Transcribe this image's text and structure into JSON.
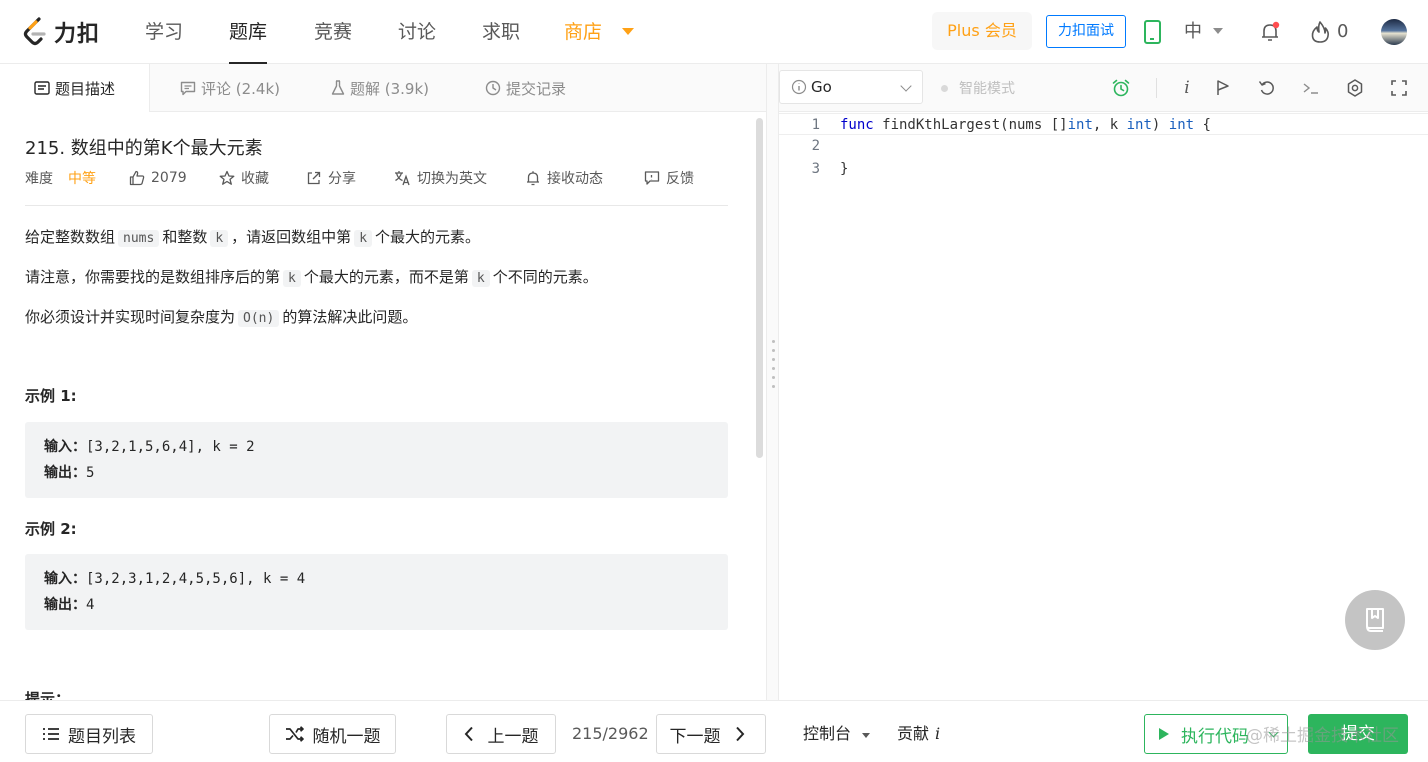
{
  "nav": {
    "logo_text": "力扣",
    "items": [
      "学习",
      "题库",
      "竞赛",
      "讨论",
      "求职",
      "商店"
    ],
    "active_index": 1,
    "plus_label": "Plus 会员",
    "interview_label": "力扣面试",
    "language": "中",
    "fire_count": "0"
  },
  "left_tabs": [
    "题目描述",
    "评论 (2.4k)",
    "题解 (3.9k)",
    "提交记录"
  ],
  "problem": {
    "title": "215. 数组中的第K个最大元素",
    "difficulty_label": "难度",
    "difficulty": "中等",
    "likes": "2079",
    "favorite": "收藏",
    "share": "分享",
    "switch_lang": "切换为英文",
    "notify": "接收动态",
    "feedback": "反馈",
    "p1_a": "给定整数数组",
    "p1_code1": "nums",
    "p1_b": "和整数",
    "p1_code2": "k",
    "p1_c": "，请返回数组中第",
    "p1_code3": "k",
    "p1_d": "个最大的元素。",
    "p2_a": "请注意，你需要找的是数组排序后的第",
    "p2_code1": "k",
    "p2_b": "个最大的元素，而不是第",
    "p2_code2": "k",
    "p2_c": "个不同的元素。",
    "p3_a": "你必须设计并实现时间复杂度为",
    "p3_code": "O(n)",
    "p3_b": "的算法解决此问题。",
    "example1_title": "示例 1:",
    "example1_input_label": "输入：",
    "example1_input": "[3,2,1,5,6,4], k = 2",
    "example1_output_label": "输出：",
    "example1_output": "5",
    "example2_title": "示例 2:",
    "example2_input_label": "输入：",
    "example2_input": "[3,2,3,1,2,4,5,5,6], k = 4",
    "example2_output_label": "输出：",
    "example2_output": "4",
    "hint_title": "提示："
  },
  "editor": {
    "language": "Go",
    "smart_mode": "智能模式",
    "info_glyph": "i",
    "line_numbers": [
      "1",
      "2",
      "3"
    ],
    "code": {
      "l1_kw": "func",
      "l1_name": " findKthLargest(nums []",
      "l1_t1": "int",
      "l1_mid": ", k ",
      "l1_t2": "int",
      "l1_sp": ") ",
      "l1_t3": "int",
      "l1_end": " {",
      "l3": "}"
    }
  },
  "bottom": {
    "problem_list": "题目列表",
    "random": "随机一题",
    "prev": "上一题",
    "page": "215/2962",
    "next": "下一题",
    "console": "控制台",
    "contribute": "贡献",
    "contribute_glyph": "i",
    "run": "执行代码",
    "submit": "提交",
    "watermark": "@稀土掘金技术社区"
  },
  "colors": {
    "accent_orange": "#ffa116",
    "accent_green": "#2db55d",
    "accent_blue": "#007aff"
  }
}
